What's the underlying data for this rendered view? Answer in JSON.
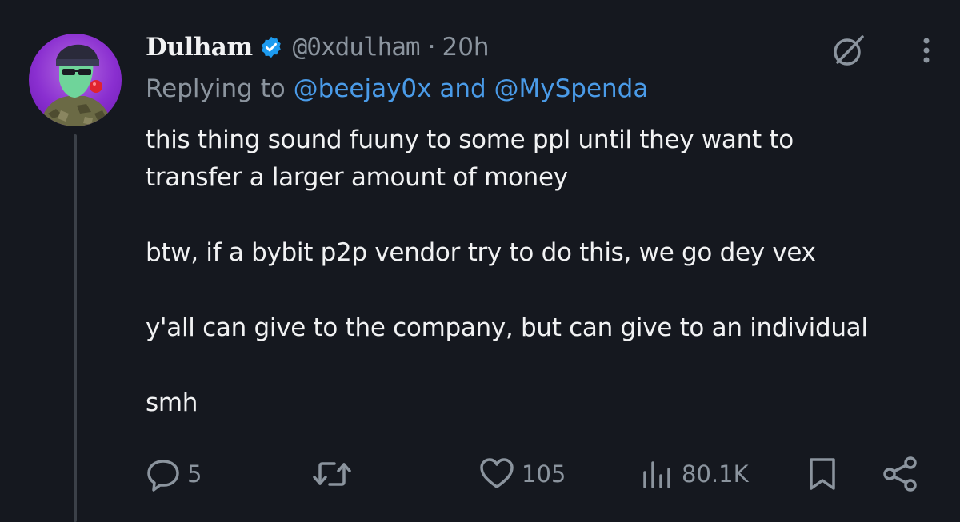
{
  "author": {
    "display_name": "Dulham",
    "handle": "@0xdulham",
    "separator": "·",
    "time": "20h",
    "verified": true
  },
  "reply": {
    "prefix": "Replying to",
    "mentions_text": "@beejay0x and @MySpenda"
  },
  "body": {
    "line1": "this thing sound fuuny to some ppl until they want to",
    "line2": "transfer a larger amount of money",
    "line3": "btw, if a bybit p2p vendor try to do this, we go dey vex",
    "line4": "y'all can give to the company, but can give to an individual",
    "line5": "smh"
  },
  "actions": {
    "replies": "5",
    "likes": "105",
    "views": "80.1K"
  },
  "colors": {
    "background": "#15181f",
    "link": "#4a9be8",
    "muted": "#8b949e",
    "verified": "#1d9bf0",
    "avatar_bg": "#8a2fd0"
  },
  "icons": {
    "verified": "verified-badge-icon",
    "grok": "grok-icon",
    "more": "more-vertical-icon",
    "reply": "reply-icon",
    "retweet": "retweet-icon",
    "like": "heart-icon",
    "views": "views-icon",
    "bookmark": "bookmark-icon",
    "share": "share-icon"
  }
}
